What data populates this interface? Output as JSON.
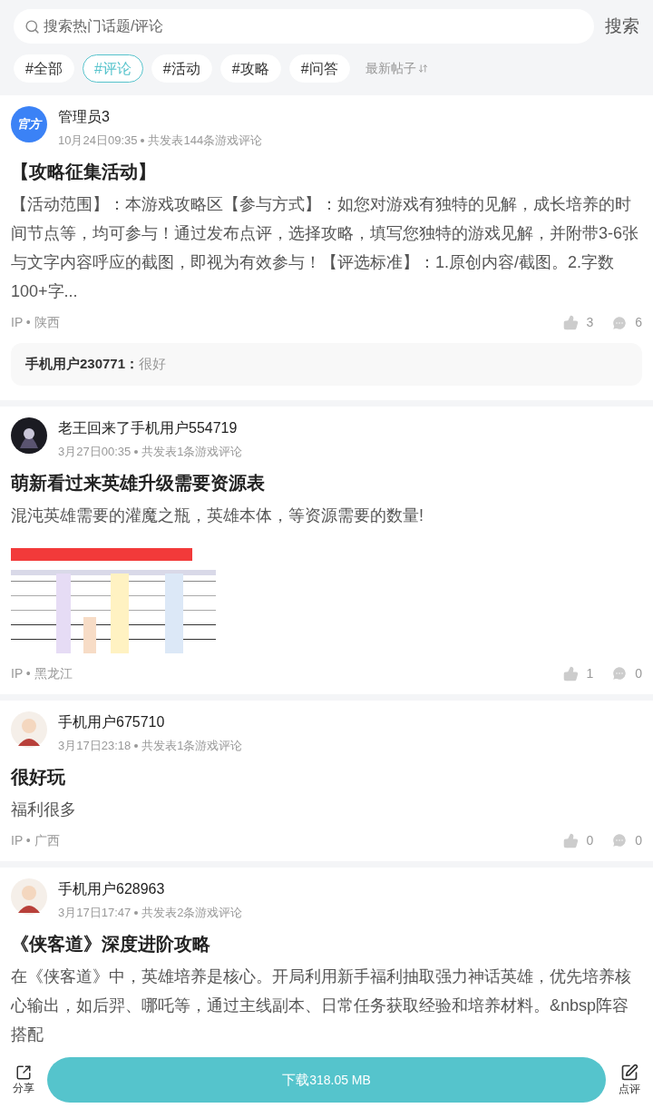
{
  "search": {
    "placeholder": "搜索热门话题/评论",
    "button": "搜索"
  },
  "tags": [
    {
      "label": "#全部",
      "selected": false
    },
    {
      "label": "#评论",
      "selected": true
    },
    {
      "label": "#活动",
      "selected": false
    },
    {
      "label": "#攻略",
      "selected": false
    },
    {
      "label": "#问答",
      "selected": false
    }
  ],
  "sort": {
    "label": "最新帖子"
  },
  "posts": [
    {
      "avatar": {
        "kind": "badge",
        "text": "官方"
      },
      "author": "管理员3",
      "date": "10月24日09:35",
      "count": "共发表144条游戏评论",
      "title": "【攻略征集活动】",
      "body": "【活动范围】：本游戏攻略区【参与方式】：如您对游戏有独特的见解，成长培养的时间节点等，均可参与！通过发布点评，选择攻略，填写您独特的游戏见解，并附带3-6张与文字内容呼应的截图，即视为有效参与！【评选标准】：1.原创内容/截图。2.字数100+字...",
      "ip": "IP • 陕西",
      "likes": "3",
      "comments": "6",
      "reply": {
        "user": "手机用户230771：",
        "text": "很好"
      }
    },
    {
      "avatar": {
        "kind": "dark"
      },
      "author": "老王回来了手机用户554719",
      "date": "3月27日00:35",
      "count": "共发表1条游戏评论",
      "title": "萌新看过来英雄升级需要资源表",
      "body": "混沌英雄需要的灌魔之瓶，英雄本体，等资源需要的数量!",
      "ip": "IP • 黑龙江",
      "likes": "1",
      "comments": "0"
    },
    {
      "avatar": {
        "kind": "figure"
      },
      "author": "手机用户675710",
      "date": "3月17日23:18",
      "count": "共发表1条游戏评论",
      "title": "很好玩",
      "body": "福利很多",
      "ip": "IP • 广西",
      "likes": "0",
      "comments": "0"
    },
    {
      "avatar": {
        "kind": "figure"
      },
      "author": "手机用户628963",
      "date": "3月17日17:47",
      "count": "共发表2条游戏评论",
      "title": "《侠客道》深度进阶攻略",
      "body": "在《侠客道》中，英雄培养是核心。开局利用新手福利抽取强力神话英雄，优先培养核心输出，如后羿、哪吒等，通过主线副本、日常任务获取经验和培养材料。&nbsp阵容搭配"
    }
  ],
  "bottom": {
    "share": "分享",
    "download": "下载",
    "size": "318.05 MB",
    "review": "点评"
  }
}
